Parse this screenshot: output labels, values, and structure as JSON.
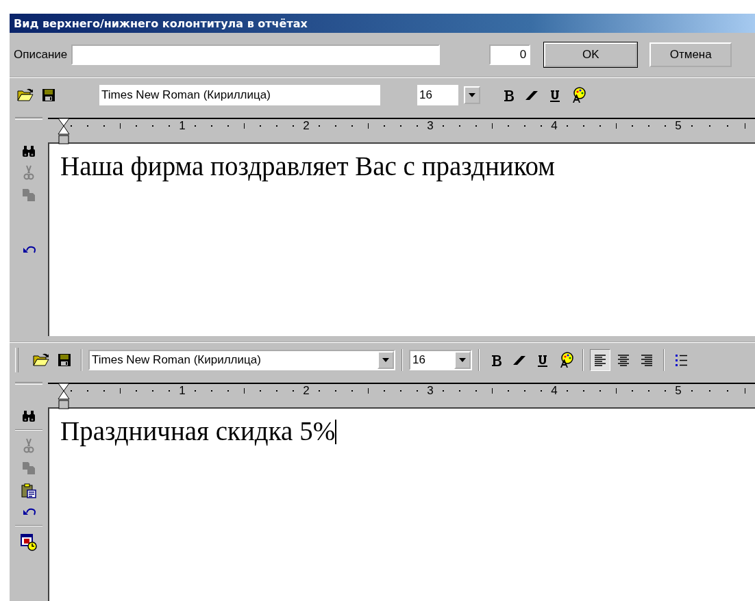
{
  "window": {
    "title": "Вид верхнего/нижнего колонтитула в отчётах"
  },
  "description": {
    "label": "Описание",
    "counter": "0"
  },
  "buttons": [
    {
      "label": "OK",
      "default": true
    },
    {
      "label": "Отмена",
      "default": false
    }
  ],
  "editors": [
    {
      "toolbar": {
        "grip": false,
        "font": "Times New Roman (Кириллица)",
        "font_dropdown": false,
        "size": "16",
        "tools": [
          {
            "kind": "open"
          },
          {
            "kind": "save"
          },
          {
            "kind": "font"
          },
          {
            "kind": "size"
          },
          {
            "kind": "bold"
          },
          {
            "kind": "italic"
          },
          {
            "kind": "underline"
          },
          {
            "kind": "color"
          }
        ]
      },
      "ruler": [
        "1",
        "2",
        "3",
        "4",
        "5"
      ],
      "side_tools": [
        {
          "kind": "find",
          "disabled": false
        },
        {
          "kind": "cut",
          "disabled": true
        },
        {
          "kind": "copy",
          "disabled": true
        },
        {
          "kind": "blank"
        },
        {
          "kind": "undo",
          "disabled": false
        }
      ],
      "text": "Наша фирма поздравляет Вас с праздником",
      "cursor": false
    },
    {
      "toolbar": {
        "grip": true,
        "font": "Times New Roman (Кириллица)",
        "font_dropdown": true,
        "size": "16",
        "tools": [
          {
            "kind": "open"
          },
          {
            "kind": "save"
          },
          {
            "kind": "separator"
          },
          {
            "kind": "font"
          },
          {
            "kind": "separator"
          },
          {
            "kind": "size"
          },
          {
            "kind": "separator"
          },
          {
            "kind": "bold"
          },
          {
            "kind": "italic"
          },
          {
            "kind": "underline"
          },
          {
            "kind": "color"
          },
          {
            "kind": "separator"
          },
          {
            "kind": "align-left",
            "selected": true
          },
          {
            "kind": "align-center",
            "selected": false
          },
          {
            "kind": "align-right",
            "selected": false
          },
          {
            "kind": "separator"
          },
          {
            "kind": "bullets"
          }
        ]
      },
      "ruler": [
        "1",
        "2",
        "3",
        "4",
        "5"
      ],
      "side_tools": [
        {
          "kind": "find",
          "disabled": false
        },
        {
          "kind": "separator"
        },
        {
          "kind": "cut",
          "disabled": true
        },
        {
          "kind": "copy",
          "disabled": true
        },
        {
          "kind": "paste",
          "disabled": false
        },
        {
          "kind": "undo",
          "disabled": false
        },
        {
          "kind": "separator"
        },
        {
          "kind": "calendar",
          "disabled": false
        }
      ],
      "text": "Праздничная скидка 5%",
      "cursor": true
    }
  ]
}
